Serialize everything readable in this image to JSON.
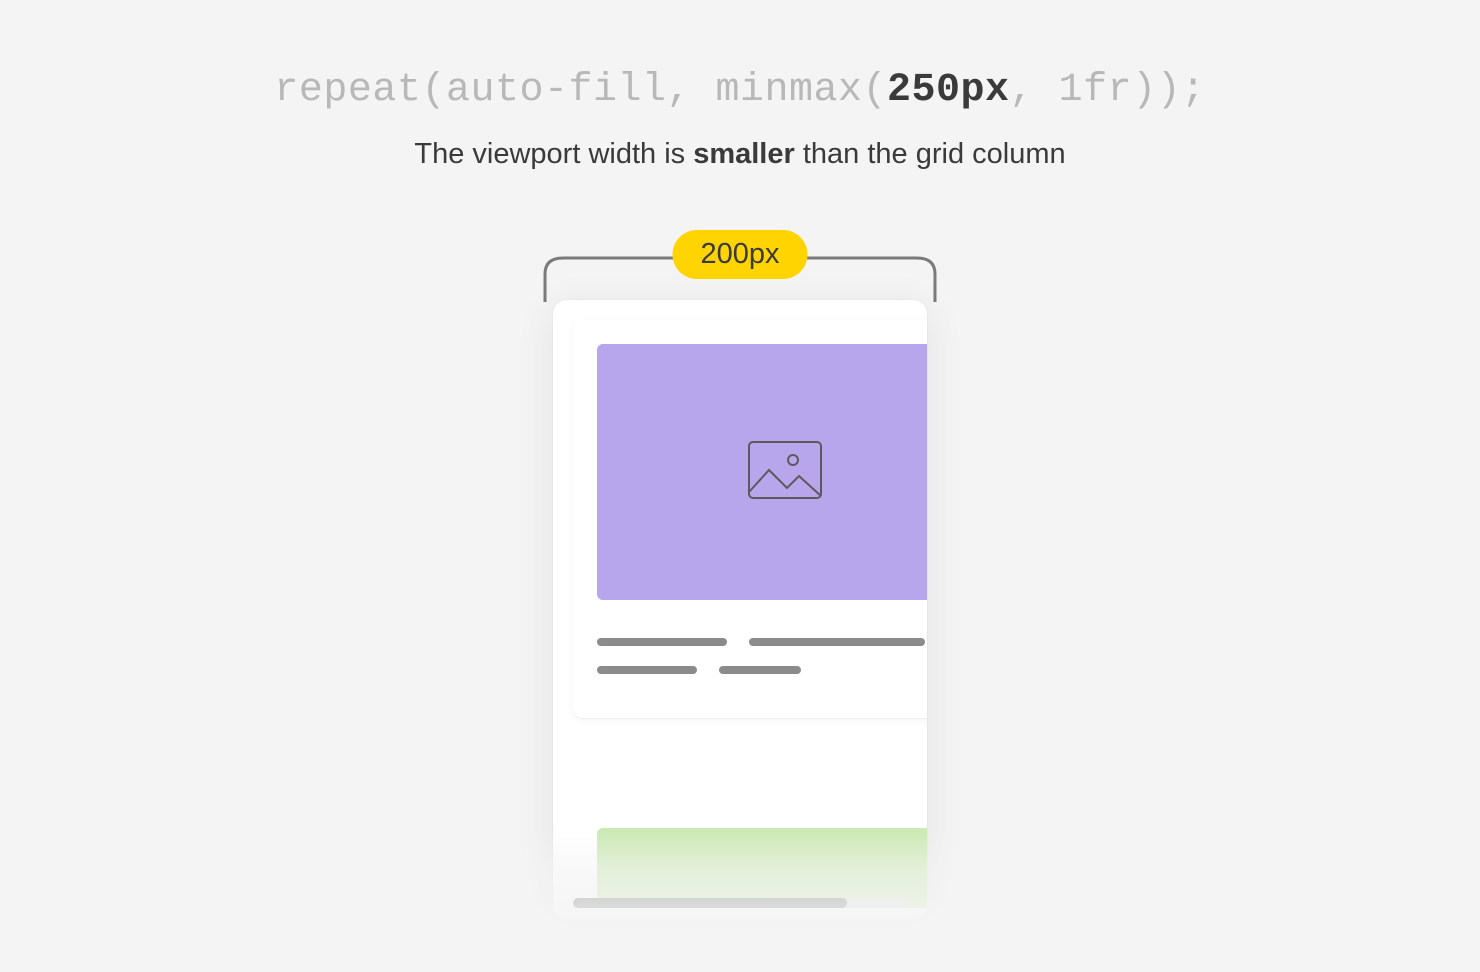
{
  "code": {
    "pre": "repeat(auto-fill, minmax(",
    "highlight": "250px",
    "post": ", 1fr));"
  },
  "caption": {
    "pre": "The viewport width is ",
    "bold": "smaller",
    "post": " than the grid column"
  },
  "badge": {
    "label": "200px"
  },
  "colors": {
    "badge_bg": "#ffd400",
    "card_image_bg": "#b8a6ed",
    "card2_image_bg": "#cbe9b2",
    "page_bg": "#f4f4f4"
  }
}
